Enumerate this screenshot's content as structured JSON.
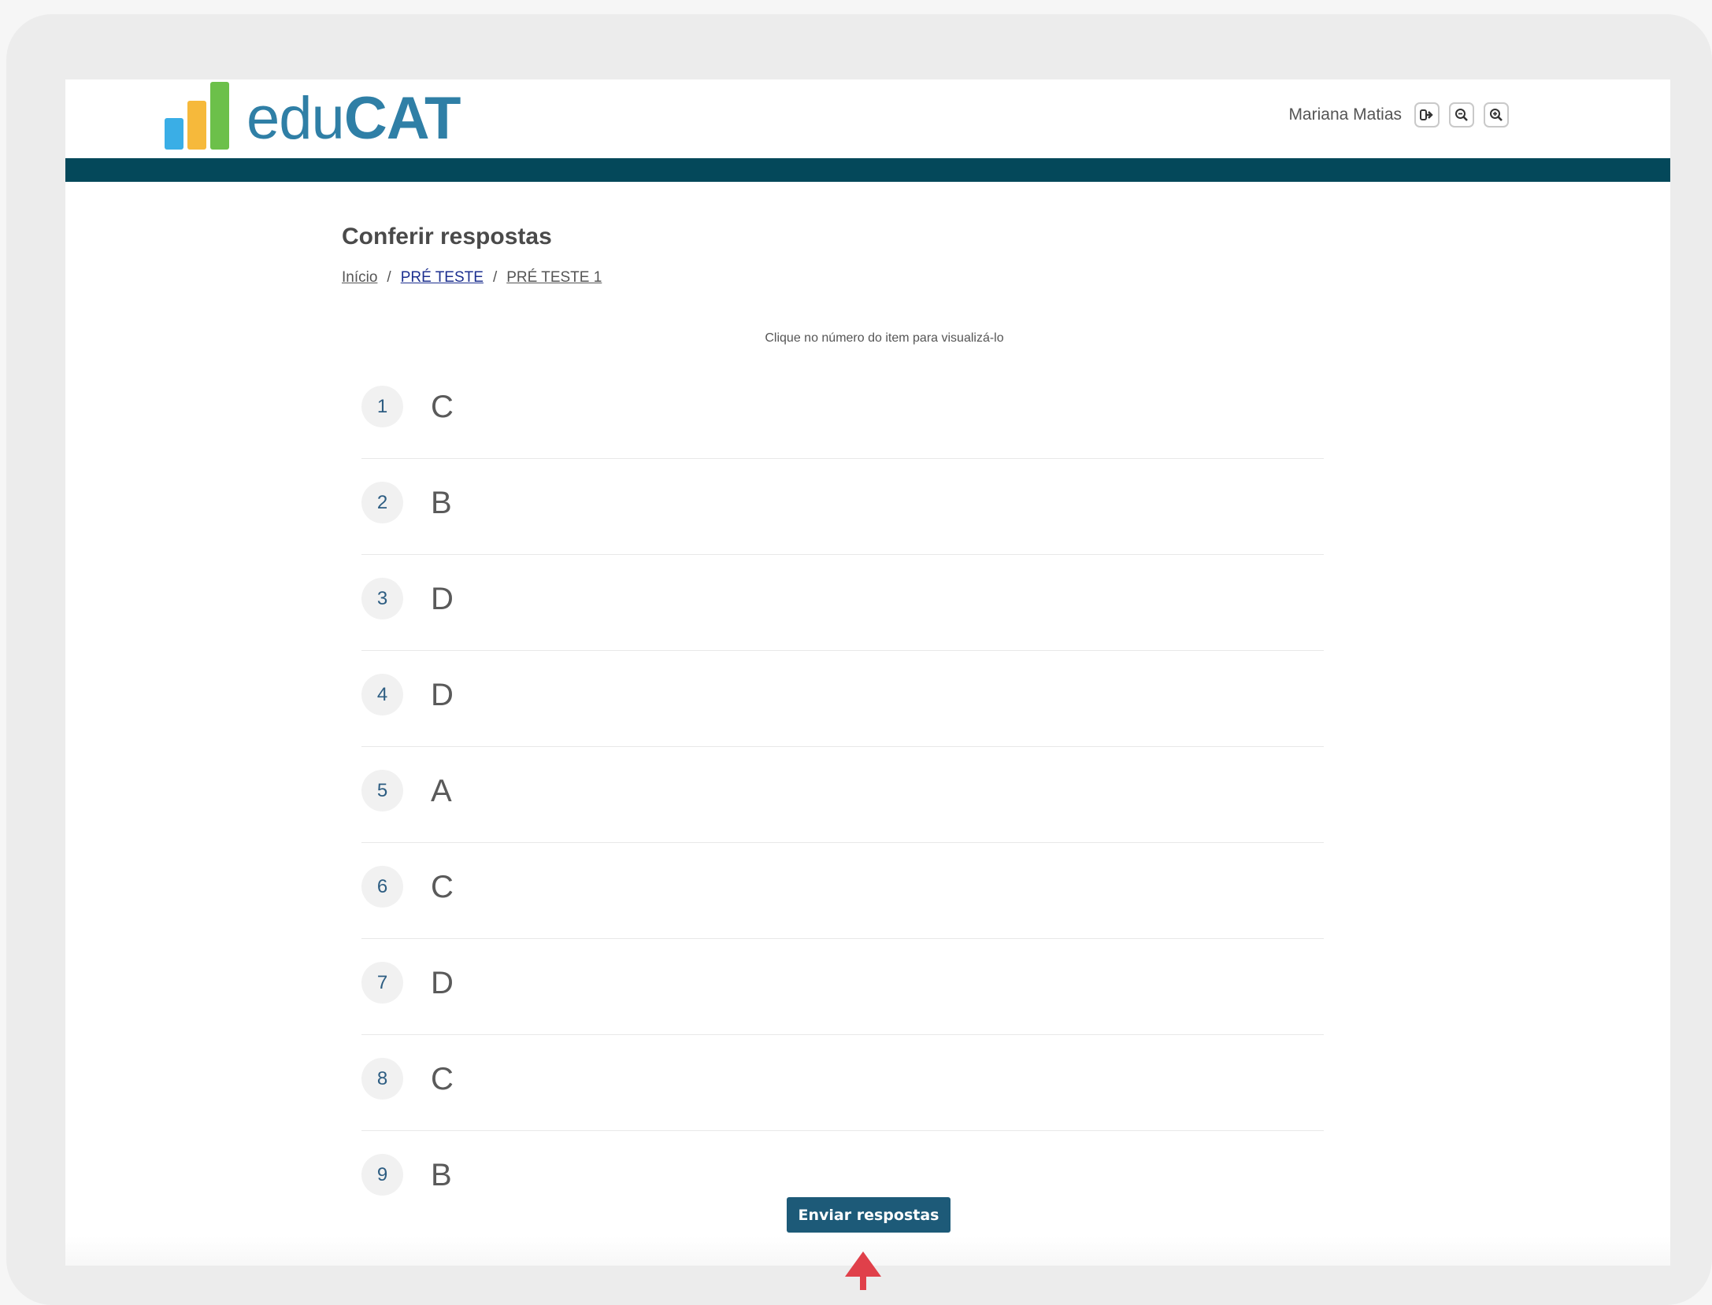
{
  "header": {
    "logo_text_light": "edu",
    "logo_text_bold": "CAT",
    "user_name": "Mariana Matias",
    "icons": [
      "logout-icon",
      "zoom-out-icon",
      "zoom-in-icon"
    ]
  },
  "page": {
    "title": "Conferir respostas",
    "breadcrumb": [
      {
        "label": "Início"
      },
      {
        "label": "PRÉ TESTE"
      },
      {
        "label": "PRÉ TESTE 1"
      }
    ],
    "separator": "/",
    "hint": "Clique no número do item para visualizá-lo"
  },
  "answers": [
    {
      "number": "1",
      "answer": "C"
    },
    {
      "number": "2",
      "answer": "B"
    },
    {
      "number": "3",
      "answer": "D"
    },
    {
      "number": "4",
      "answer": "D"
    },
    {
      "number": "5",
      "answer": "A"
    },
    {
      "number": "6",
      "answer": "C"
    },
    {
      "number": "7",
      "answer": "D"
    },
    {
      "number": "8",
      "answer": "C"
    },
    {
      "number": "9",
      "answer": "B"
    }
  ],
  "actions": {
    "submit_label": "Enviar respostas"
  },
  "colors": {
    "header_band": "#04485a",
    "submit_button": "#1d5a78",
    "pointer_arrow": "#e0404a",
    "logo_blue": "#3aaee6",
    "logo_yellow": "#f6b93b",
    "logo_green": "#6cc04a"
  }
}
